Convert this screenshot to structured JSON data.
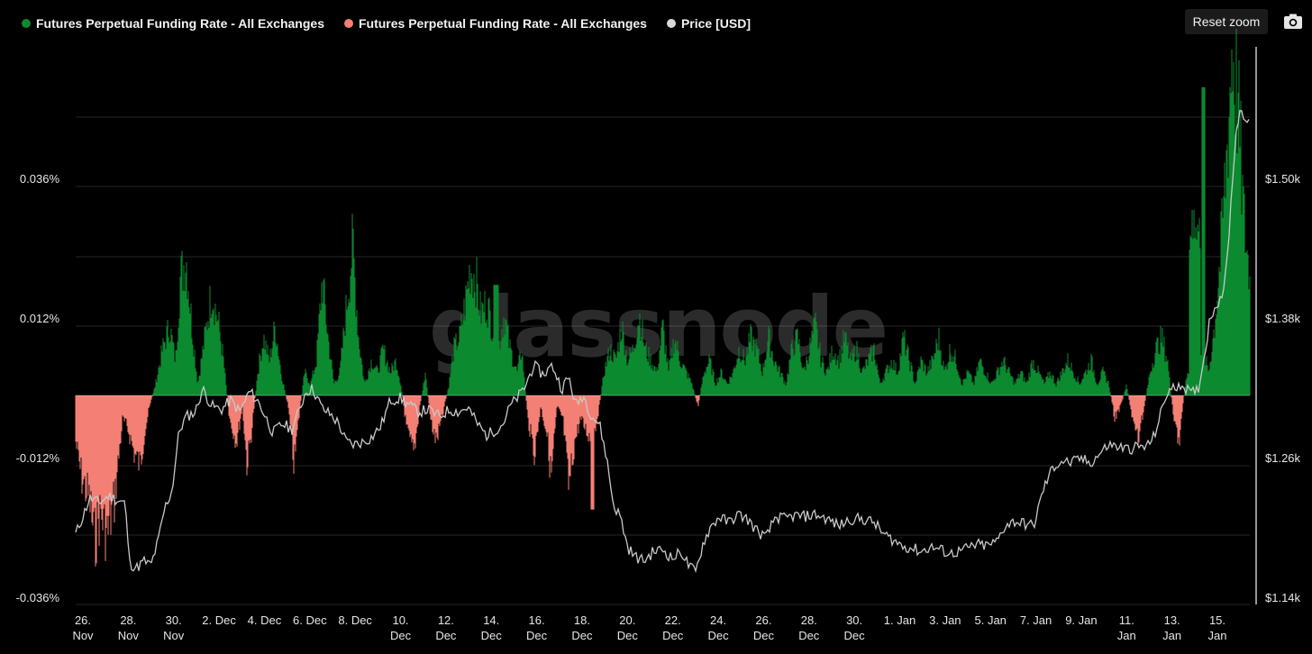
{
  "legend": {
    "positive_label": "Futures Perpetual Funding Rate - All Exchanges",
    "negative_label": "Futures Perpetual Funding Rate - All Exchanges",
    "price_label": "Price [USD]"
  },
  "toolbar": {
    "reset_zoom_label": "Reset zoom",
    "camera_icon": "camera-icon"
  },
  "watermark": "glassnode",
  "colors": {
    "positive": "#0b8a30",
    "negative": "#f47f74",
    "price": "#c9c9c9",
    "grid": "#262626",
    "background": "#000000"
  },
  "chart_data": {
    "type": "area",
    "x_ticks": [
      [
        "26.",
        "Nov"
      ],
      [
        "28.",
        "Nov"
      ],
      [
        "30.",
        "Nov"
      ],
      [
        "2. Dec"
      ],
      [
        "4. Dec"
      ],
      [
        "6. Dec"
      ],
      [
        "8. Dec"
      ],
      [
        "10.",
        "Dec"
      ],
      [
        "12.",
        "Dec"
      ],
      [
        "14.",
        "Dec"
      ],
      [
        "16.",
        "Dec"
      ],
      [
        "18.",
        "Dec"
      ],
      [
        "20.",
        "Dec"
      ],
      [
        "22.",
        "Dec"
      ],
      [
        "24.",
        "Dec"
      ],
      [
        "26.",
        "Dec"
      ],
      [
        "28.",
        "Dec"
      ],
      [
        "30.",
        "Dec"
      ],
      [
        "1. Jan"
      ],
      [
        "3. Jan"
      ],
      [
        "5. Jan"
      ],
      [
        "7. Jan"
      ],
      [
        "9. Jan"
      ],
      [
        "11.",
        "Jan"
      ],
      [
        "13.",
        "Jan"
      ],
      [
        "15.",
        "Jan"
      ]
    ],
    "y_left_ticks": [
      "0.036%",
      "0.012%",
      "-0.012%",
      "-0.036%"
    ],
    "y_right_ticks": [
      "$1.50k",
      "$1.38k",
      "$1.26k",
      "$1.14k"
    ],
    "y_left_range": [
      -0.036,
      0.036
    ],
    "y_right_range": [
      1140,
      1500
    ],
    "grid": true,
    "legend_position": "top-left",
    "series": [
      {
        "name": "Futures Perpetual Funding Rate - All Exchanges",
        "axis": "left",
        "unit": "%",
        "sign": "positive",
        "color": "#0b8a30"
      },
      {
        "name": "Futures Perpetual Funding Rate - All Exchanges",
        "axis": "left",
        "unit": "%",
        "sign": "negative",
        "color": "#f47f74"
      },
      {
        "name": "Price [USD]",
        "axis": "right",
        "unit": "USD",
        "color": "#c9c9c9"
      }
    ],
    "funding_rate": {
      "x": [
        25.9,
        26.3,
        26.7,
        27.0,
        27.4,
        27.8,
        28.1,
        28.5,
        28.9,
        29.2,
        29.6,
        30.0,
        30.4,
        30.7,
        1.1,
        1.5,
        1.8,
        2.2,
        2.6,
        2.9,
        3.3,
        3.7,
        4.0,
        4.4,
        4.8,
        5.2,
        5.5,
        5.9,
        6.3,
        6.6,
        7.0,
        7.4,
        7.7,
        8.1,
        8.5,
        8.8,
        9.2,
        9.6,
        9.9,
        10.3,
        10.7,
        11.0,
        11.4,
        11.8,
        12.2,
        12.5,
        12.9,
        13.3,
        13.6,
        14.0,
        14.4,
        14.7,
        15.1,
        15.5,
        15.8,
        16.2,
        16.6,
        16.9,
        17.3,
        17.7,
        18.0,
        18.4,
        18.8,
        19.1,
        19.5,
        19.9,
        20.2,
        20.6,
        21.0,
        21.3,
        21.7,
        22.1,
        22.4,
        22.8,
        23.2,
        23.6,
        23.9,
        24.3,
        24.7,
        25.0,
        25.4,
        25.8,
        26.1,
        26.5,
        26.9,
        27.2,
        27.6,
        28.0,
        28.3,
        28.7,
        29.1,
        29.4,
        29.8,
        30.2,
        30.6,
        30.9,
        31.3,
        31.7,
        32.0,
        32.4,
        32.8,
        33.1,
        33.5,
        33.9,
        34.2,
        34.6,
        35.0,
        35.3,
        35.7,
        36.1,
        36.4,
        36.8,
        37.2,
        37.5,
        37.9,
        38.3,
        38.6,
        39.0,
        39.4,
        39.8,
        40.1,
        40.5,
        40.9,
        41.2,
        41.6,
        42.0,
        42.3,
        42.7,
        43.1,
        43.4,
        43.8,
        44.2,
        44.5,
        44.9,
        45.3,
        45.6,
        46.0,
        46.4,
        46.7,
        47.1,
        47.4
      ],
      "note_x_axis": "days"
    }
  }
}
